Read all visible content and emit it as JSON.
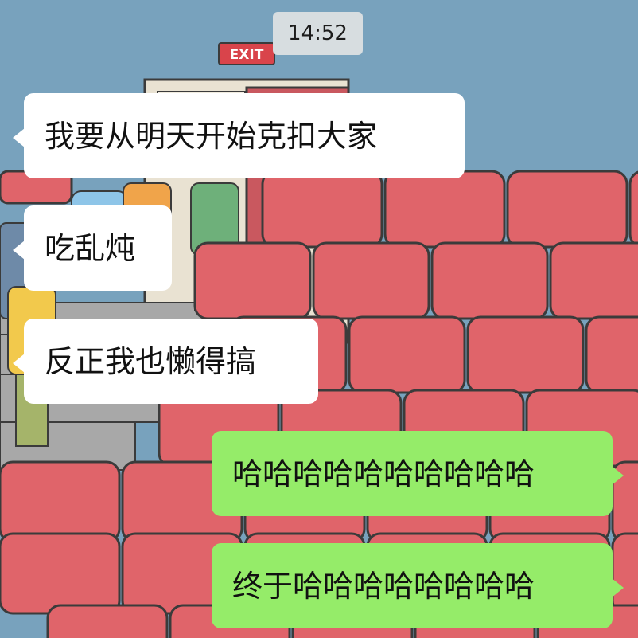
{
  "chat": {
    "timestamp": "14:52",
    "wallpaper": {
      "description_icon": "cinema-seats-wallpaper",
      "exit_sign": "EXIT",
      "colors": {
        "sky": "#78a2bd",
        "seat": "#e0646a",
        "seat_dark": "#c44f57"
      }
    },
    "messages": [
      {
        "side": "incoming",
        "text": "我要从明天开始克扣大家"
      },
      {
        "side": "incoming",
        "text": "吃乱炖"
      },
      {
        "side": "incoming",
        "text": "反正我也懒得搞"
      },
      {
        "side": "outgoing",
        "text": "哈哈哈哈哈哈哈哈哈哈"
      },
      {
        "side": "outgoing",
        "text": "终于哈哈哈哈哈哈哈哈"
      }
    ],
    "colors": {
      "incoming_bubble": "#ffffff",
      "outgoing_bubble": "#95ec69",
      "time_badge": "#d7dde0"
    }
  }
}
